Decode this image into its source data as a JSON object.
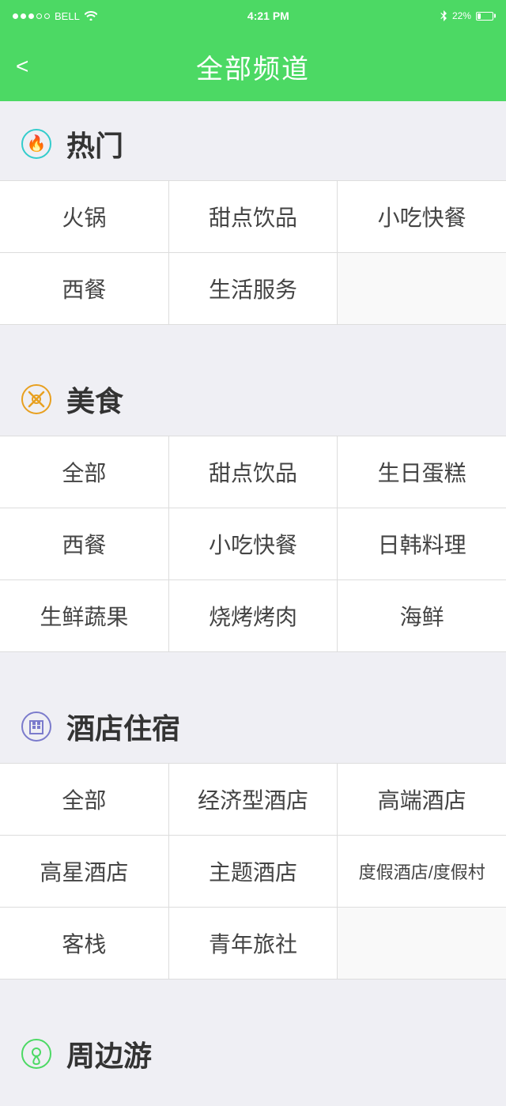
{
  "statusBar": {
    "signal": [
      "filled",
      "filled",
      "filled",
      "empty",
      "empty"
    ],
    "carrier": "BELL",
    "wifi": true,
    "time": "4:21 PM",
    "bluetooth": true,
    "battery": "22%"
  },
  "navBar": {
    "backLabel": "<",
    "title": "全部频道"
  },
  "sections": [
    {
      "id": "hot",
      "iconType": "hot",
      "title": "热门",
      "items": [
        [
          "火锅",
          "甜点饮品",
          "小吃快餐"
        ],
        [
          "西餐",
          "生活服务",
          ""
        ]
      ]
    },
    {
      "id": "food",
      "iconType": "food",
      "title": "美食",
      "items": [
        [
          "全部",
          "甜点饮品",
          "生日蛋糕"
        ],
        [
          "西餐",
          "小吃快餐",
          "日韩料理"
        ],
        [
          "生鲜蔬果",
          "烧烤烤肉",
          "海鲜"
        ]
      ]
    },
    {
      "id": "hotel",
      "iconType": "hotel",
      "title": "酒店住宿",
      "items": [
        [
          "全部",
          "经济型酒店",
          "高端酒店"
        ],
        [
          "高星酒店",
          "主题酒店",
          "度假酒店/度假村"
        ],
        [
          "客栈",
          "青年旅社",
          ""
        ]
      ]
    },
    {
      "id": "nearby",
      "iconType": "nearby",
      "title": "周边游",
      "items": []
    }
  ]
}
